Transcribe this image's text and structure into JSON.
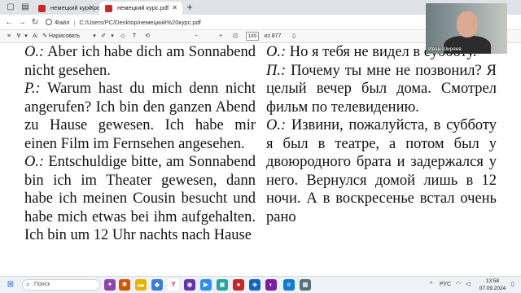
{
  "browser": {
    "tabs": [
      {
        "title": "немецкий курс.pdf"
      },
      {
        "title": "немецкий курс.pdf"
      }
    ],
    "address": {
      "scheme_label": "Файл",
      "path": "C:/Users/PC/Desktop/немецкий%20курс.pdf"
    }
  },
  "pdf_toolbar": {
    "draw_label": "Нарисовать",
    "zoom_out": "−",
    "zoom_in": "+",
    "page_current": "189",
    "page_total": "из 877"
  },
  "webcam": {
    "name": "Иван Ширяев"
  },
  "document": {
    "left": [
      {
        "speaker": "O.:",
        "text": " Aber ich habe dich am Sonnabend nicht gesehen."
      },
      {
        "speaker": "P.:",
        "text": " Warum hast du mich denn nicht angerufen? Ich bin den ganzen Abend zu Hause gewesen. Ich habe mir einen Film im Fernsehen angesehen."
      },
      {
        "speaker": "O.:",
        "text": " Entschuldige bitte, am Sonnabend bin ich im Theater gewesen, dann habe ich meinen Cousin besucht und habe mich etwas bei ihm aufgehalten. Ich bin um 12 Uhr nachts nach Hause"
      }
    ],
    "right": [
      {
        "speaker": "O.:",
        "text": " Но я тебя не видел в субботу."
      },
      {
        "speaker": "П.:",
        "text": " Почему ты мне не позвонил? Я целый вечер был дома. Смотрел фильм по телевидению."
      },
      {
        "speaker": "O.:",
        "text": " Извини, пожалуйста, в субботу я был в театре, а потом был у двоюродного брата и задержался у него. Вернулся домой лишь в 12 ночи. А в воскресенье встал очень рано"
      }
    ]
  },
  "taskbar": {
    "search_placeholder": "Поиск",
    "language": "РУС",
    "time": "13:58",
    "date": "07.09.2024"
  }
}
